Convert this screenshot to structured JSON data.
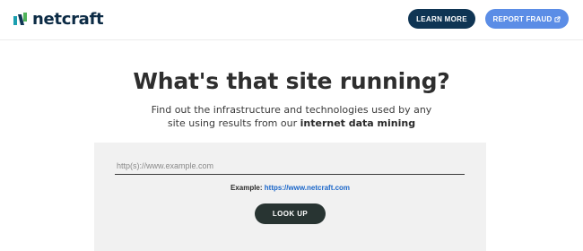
{
  "header": {
    "logo_text": "netcraft",
    "learn_more_label": "LEARN MORE",
    "report_fraud_label": "REPORT FRAUD",
    "colors": {
      "brand_dark": "#0f3554",
      "accent_blue": "#5b8de6",
      "logo_green": "#4fb35a",
      "logo_teal": "#1b9fb0"
    }
  },
  "hero": {
    "title": "What's that site running?",
    "subtitle_line1": "Find out the infrastructure and technologies used by any",
    "subtitle_line2_prefix": "site using results from our ",
    "subtitle_line2_bold": "internet data mining"
  },
  "lookup": {
    "input_placeholder": "http(s)://www.example.com",
    "input_value": "",
    "example_label": "Example: ",
    "example_link": "https://www.netcraft.com",
    "button_label": "LOOK UP"
  }
}
